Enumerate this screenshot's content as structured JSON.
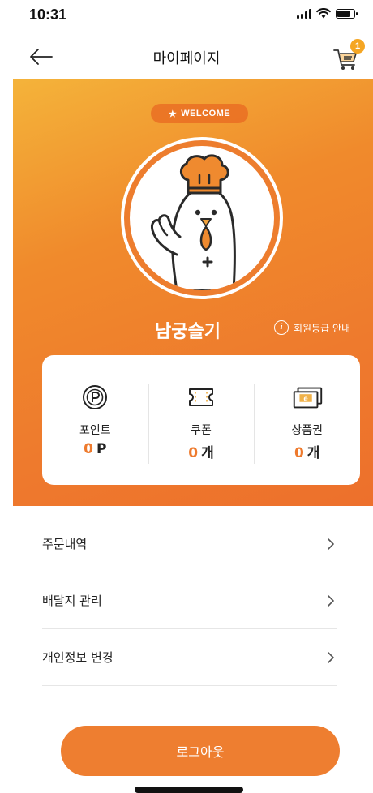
{
  "status_bar": {
    "time": "10:31",
    "icons": [
      "signal-icon",
      "wifi-icon",
      "battery-icon"
    ],
    "battery_level": 0.8
  },
  "header": {
    "title": "마이페이지",
    "back_icon": "arrow-left-icon",
    "cart_icon": "cart-icon",
    "cart_badge": "1"
  },
  "profile": {
    "welcome_label": "WELCOME",
    "welcome_icon": "star-icon",
    "avatar_icon": "chicken-chef-character",
    "name": "남궁슬기",
    "grade_link": "회원등급 안내"
  },
  "stats": [
    {
      "icon": "point-coin-icon",
      "label": "포인트",
      "value": "0",
      "unit": "P"
    },
    {
      "icon": "coupon-ticket-icon",
      "label": "쿠폰",
      "value": "0",
      "unit": "개"
    },
    {
      "icon": "gift-card-icon",
      "label": "상품권",
      "value": "0",
      "unit": "개"
    }
  ],
  "menu": [
    {
      "label": "주문내역"
    },
    {
      "label": "배달지 관리"
    },
    {
      "label": "개인정보 변경"
    }
  ],
  "logout_label": "로그아웃",
  "colors": {
    "accent": "#ee7a2d",
    "hero_gradient_start": "#f4b33a",
    "hero_gradient_end": "#ed702c",
    "badge": "#f5a623",
    "logout_button": "#ee7e30"
  }
}
